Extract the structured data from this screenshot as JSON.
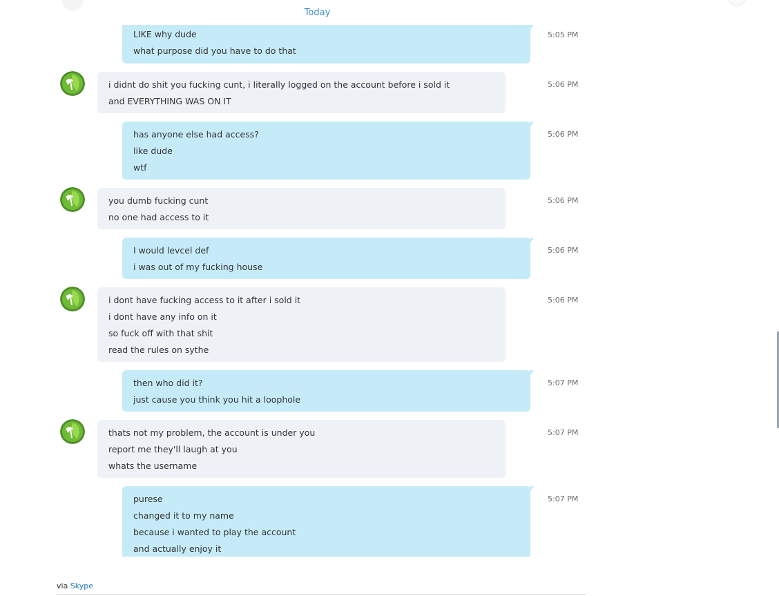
{
  "conversation": {
    "day_label": "Today",
    "messages": [
      {
        "side": "outgoing",
        "time": "5:05 PM",
        "lines": [
          "LIKE why dude",
          "what purpose did you have to do that"
        ]
      },
      {
        "side": "incoming",
        "time": "5:06 PM",
        "lines": [
          "i didnt do shit you fucking cunt, i literally logged on the account before i sold it",
          "and EVERYTHING WAS ON IT"
        ]
      },
      {
        "side": "outgoing",
        "time": "5:06 PM",
        "lines": [
          "has anyone else had access?",
          "like dude",
          "wtf"
        ]
      },
      {
        "side": "incoming",
        "time": "5:06 PM",
        "lines": [
          "you dumb fucking cunt",
          "no one had access to it"
        ]
      },
      {
        "side": "outgoing",
        "time": "5:06 PM",
        "lines": [
          "I would levcel def",
          "i was out of my fucking house"
        ]
      },
      {
        "side": "incoming",
        "time": "5:06 PM",
        "lines": [
          "i dont have fucking access to it after i sold it",
          "i dont have any info on it",
          "so fuck off with that shit",
          "read the rules on sythe"
        ]
      },
      {
        "side": "outgoing",
        "time": "5:07 PM",
        "lines": [
          "then who did it?",
          "just cause you think you hit a loophole"
        ]
      },
      {
        "side": "incoming",
        "time": "5:07 PM",
        "lines": [
          "thats not my problem, the account is under you",
          "report me they'll laugh at you",
          "whats the username"
        ]
      },
      {
        "side": "outgoing",
        "time": "5:07 PM",
        "lines": [
          "purese",
          "changed it to my name",
          "because i wanted to play the account",
          "and actually enjoy it"
        ]
      }
    ]
  },
  "footer": {
    "prefix": "via",
    "link": "Skype"
  },
  "colors": {
    "outgoing_bubble": "#c6ebf8",
    "incoming_bubble": "#eef2f7",
    "link": "#1f78b4",
    "day_label": "#3b8fc9"
  },
  "icons": {
    "contact_avatar": "green-leaf-avatar-icon"
  }
}
